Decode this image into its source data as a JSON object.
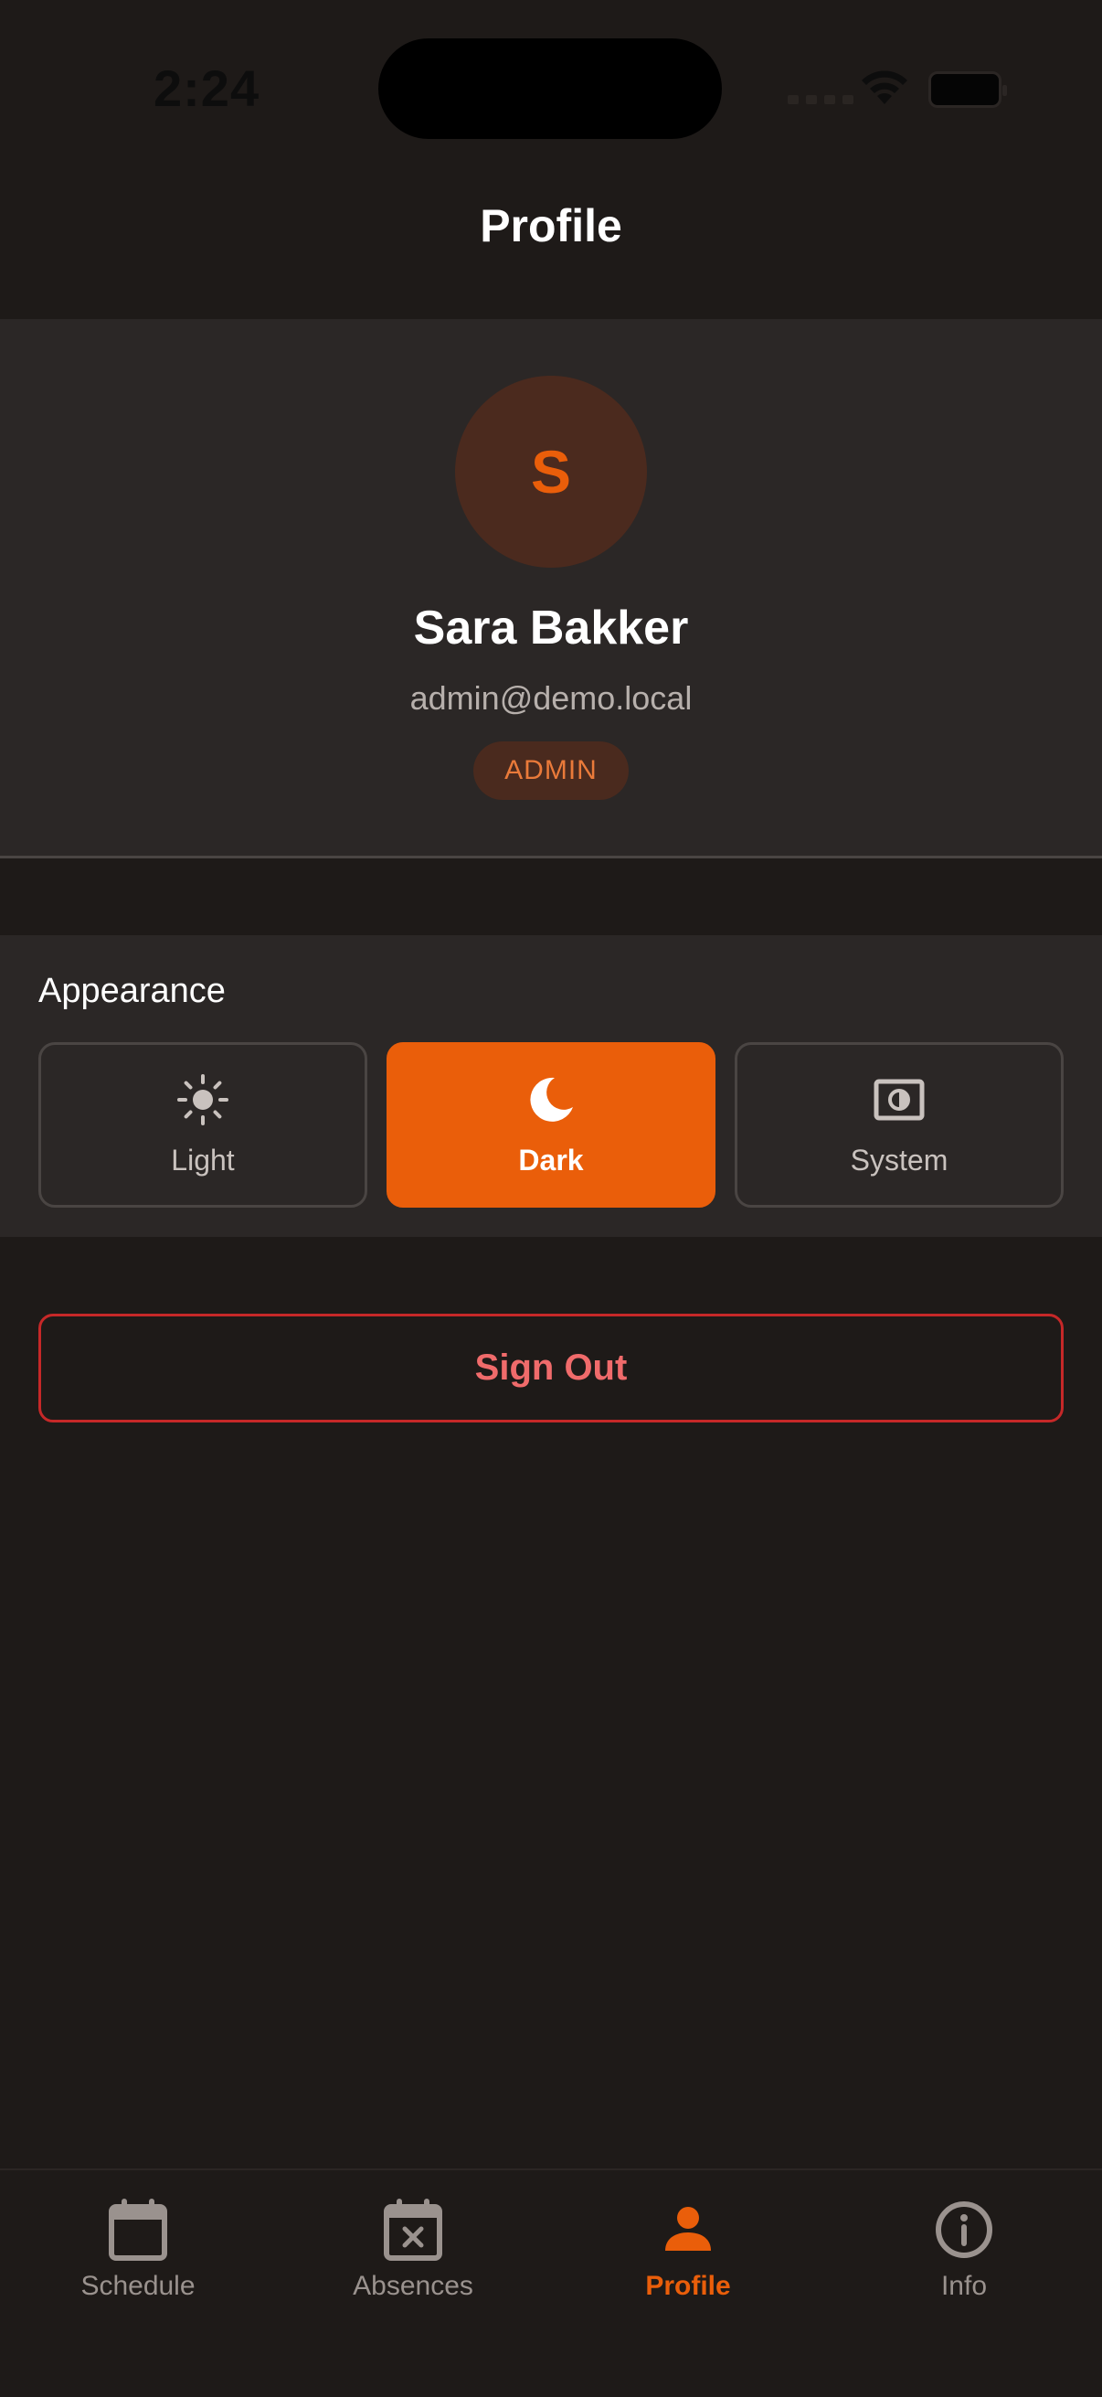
{
  "status_bar": {
    "time": "2:24"
  },
  "header": {
    "title": "Profile"
  },
  "profile": {
    "initial": "S",
    "name": "Sara Bakker",
    "email": "admin@demo.local",
    "role": "ADMIN"
  },
  "appearance": {
    "title": "Appearance",
    "options": [
      {
        "label": "Light",
        "icon": "sun-icon",
        "selected": false
      },
      {
        "label": "Dark",
        "icon": "moon-icon",
        "selected": true
      },
      {
        "label": "System",
        "icon": "brightness-icon",
        "selected": false
      }
    ]
  },
  "actions": {
    "sign_out": "Sign Out"
  },
  "bottom_nav": {
    "items": [
      {
        "label": "Schedule",
        "icon": "calendar-icon",
        "active": false
      },
      {
        "label": "Absences",
        "icon": "calendar-x-icon",
        "active": false
      },
      {
        "label": "Profile",
        "icon": "person-icon",
        "active": true
      },
      {
        "label": "Info",
        "icon": "info-icon",
        "active": false
      }
    ]
  },
  "colors": {
    "background": "#1e1a18",
    "card": "#2b2726",
    "accent": "#ea5e0a",
    "danger": "#c62828"
  }
}
